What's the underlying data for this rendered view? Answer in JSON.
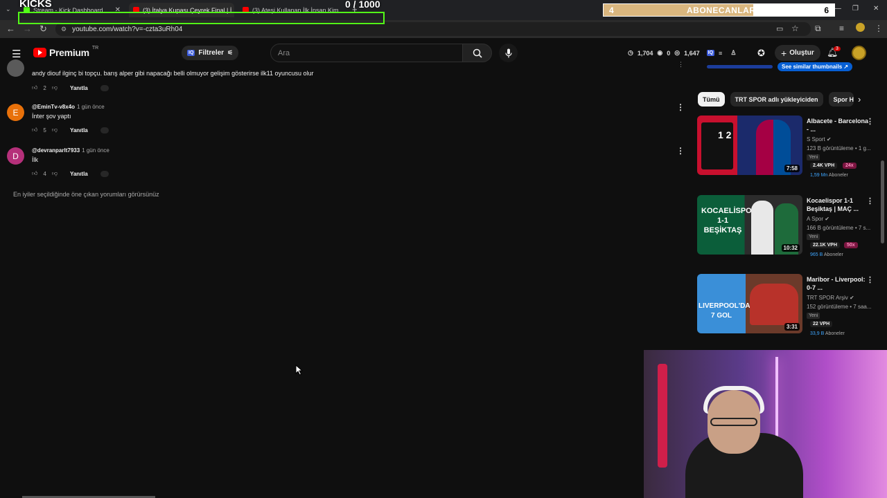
{
  "browser": {
    "tabs": [
      {
        "title": "Stream - Kick Dashboard",
        "active": false
      },
      {
        "title": "(3) İtalya Kupası Çeyrek Final | İ...",
        "active": true
      },
      {
        "title": "(3) Ateşi Kullanan İlk İnsan Kim...",
        "active": false
      }
    ],
    "url": "youtube.com/watch?v=-czta3uRh04"
  },
  "overlay": {
    "kicks_label": "KICKS",
    "counter": "0 / 1000",
    "subgoal_left": "4",
    "subgoal_label": "ABONECANLAR",
    "subgoal_right": "6",
    "subgoal_progress": 0.65
  },
  "yt_header": {
    "logo_text": "Premium",
    "region": "TR",
    "filters_label": "Filtreler",
    "search_placeholder": "Ara",
    "stats": [
      "1,704",
      "0",
      "1,647"
    ],
    "create_label": "Oluştur",
    "notif_count": "3"
  },
  "comments": [
    {
      "handle": "",
      "ago": "",
      "text": "andy diouf ilginç bi topçu. barış alper gibi napacağı belli olmuyor gelişim gösterirse ilk11 oyuncusu olur",
      "likes": "2",
      "reply": "Yanıtla",
      "avatar_letter": "",
      "avatar_color": "#5a5a5a"
    },
    {
      "handle": "@EminTv-v8x4o",
      "ago": "1 gün önce",
      "text": "İnter şov yaptı",
      "likes": "5",
      "reply": "Yanıtla",
      "avatar_letter": "E",
      "avatar_color": "#e8710a"
    },
    {
      "handle": "@devranparlt7933",
      "ago": "1 gün önce",
      "text": "İlk",
      "likes": "4",
      "reply": "Yanıtla",
      "avatar_letter": "D",
      "avatar_color": "#b5307a"
    }
  ],
  "comments_note": "En iyiler seçildiğinde öne çıkan yorumları görürsünüz",
  "sidebar": {
    "similar_label": "See similar thumbnails",
    "chips": [
      "Tümü",
      "TRT SPOR adlı yükleyiciden",
      "Spor H"
    ],
    "videos": [
      {
        "title": "Albacete - Barcelona - ...",
        "channel": "S Sport",
        "meta": "123 B görüntüleme • 1 g...",
        "new": "Yeni",
        "vph": "2.4K VPH",
        "mult": "24x",
        "subs_num": "1,59 Mn",
        "subs_label": "Aboneler",
        "duration": "7:58",
        "thumb_text": "1  2"
      },
      {
        "title": "Kocaelispor 1-1 Beşiktaş | MAÇ ...",
        "channel": "A Spor",
        "meta": "166 B görüntüleme • 7 s...",
        "new": "Yeni",
        "vph": "22.1K VPH",
        "mult": "50x",
        "subs_num": "965 B",
        "subs_label": "Aboneler",
        "duration": "10:32",
        "thumb_text": "KOCAELİSPOR 1-1 BEŞİKTAŞ"
      },
      {
        "title": "Maribor - Liverpool: 0-7 ...",
        "channel": "TRT SPOR Arşiv",
        "meta": "152 görüntüleme • 7 saa...",
        "new": "Yeni",
        "vph": "22 VPH",
        "mult": "",
        "subs_num": "33,9 B",
        "subs_label": "Aboneler",
        "duration": "3:31",
        "thumb_text": "LIVERPOOL'DAN 7 GOL"
      }
    ]
  },
  "colors": {
    "kick_green": "#53fc18",
    "yt_red": "#ff0000",
    "link_blue": "#3ea6ff"
  }
}
